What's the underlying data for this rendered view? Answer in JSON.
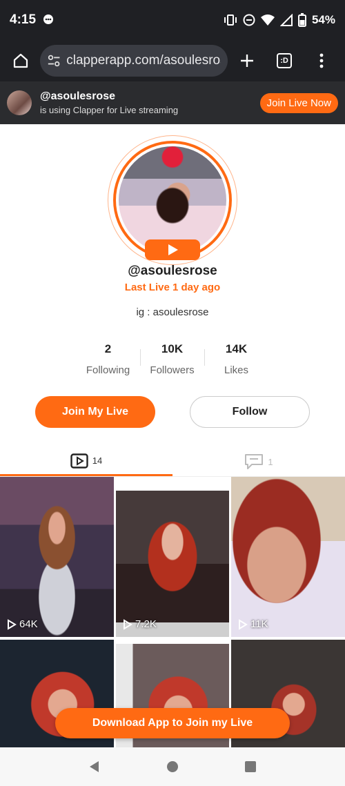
{
  "status_bar": {
    "time": "4:15",
    "battery": "54%"
  },
  "browser": {
    "url": "clapperapp.com/asoulesrose",
    "tab_icon_text": ":D"
  },
  "banner": {
    "handle": "@asoulesrose",
    "subtitle": "is using Clapper for Live streaming",
    "join_label": "Join Live Now"
  },
  "profile": {
    "handle": "@asoulesrose",
    "last_live": "Last Live 1 day ago",
    "bio": "ig : asoulesrose",
    "stats": [
      {
        "value": "2",
        "label": "Following"
      },
      {
        "value": "10K",
        "label": "Followers"
      },
      {
        "value": "14K",
        "label": "Likes"
      }
    ],
    "join_live_label": "Join My Live",
    "follow_label": "Follow"
  },
  "tabs": {
    "videos_count": "14",
    "comments_count": "1"
  },
  "videos": [
    {
      "views": "64K"
    },
    {
      "views": "7.2K"
    },
    {
      "views": "11K"
    }
  ],
  "download_label": "Download App to Join my Live",
  "colors": {
    "accent": "#ff6a13",
    "bar_dark": "#1f2024"
  }
}
